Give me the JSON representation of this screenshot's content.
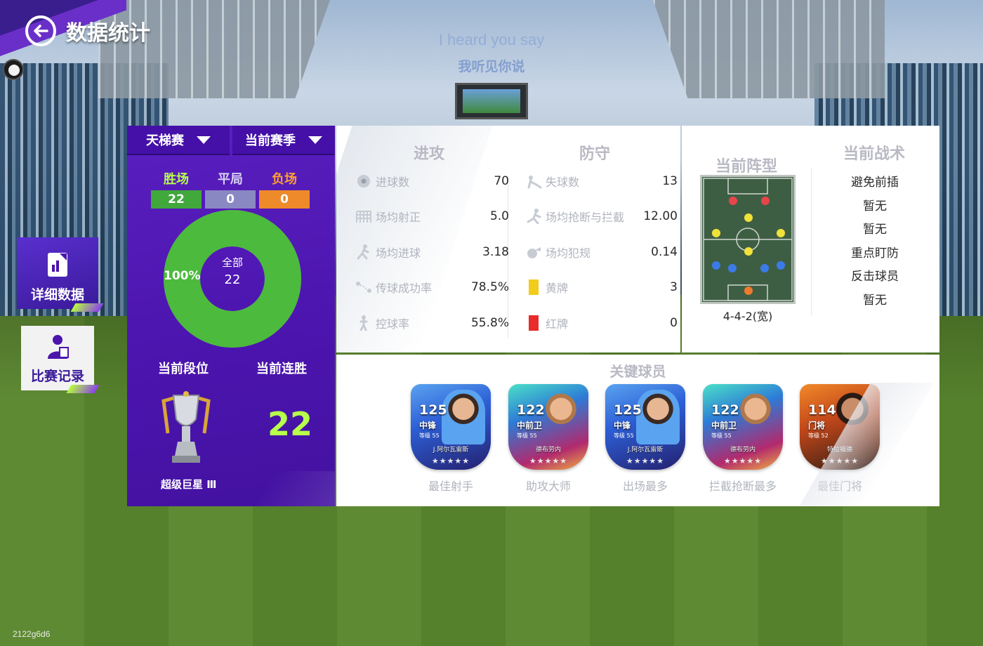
{
  "header": {
    "title": "数据统计"
  },
  "overlay": {
    "lyric_en": "I heard you say",
    "lyric_cn": "我听见你说"
  },
  "sidebar": {
    "detail_label": "详细数据",
    "record_label": "比赛记录"
  },
  "summary": {
    "mode_dropdown": "天梯赛",
    "season_dropdown": "当前赛季",
    "wins_label": "胜场",
    "wins": "22",
    "draws_label": "平局",
    "draws": "0",
    "losses_label": "负场",
    "losses": "0",
    "donut_center_label": "全部",
    "donut_center_value": "22",
    "donut_pct": "100%",
    "win_fraction": 1.0,
    "rank_label": "当前段位",
    "streak_label": "当前连胜",
    "streak_value": "22",
    "rank_name": "超级巨星 Ⅲ"
  },
  "stats": {
    "attack_title": "进攻",
    "defense_title": "防守",
    "attack": [
      {
        "icon": "ball-icon",
        "name": "进球数",
        "value": "70"
      },
      {
        "icon": "goal-net-icon",
        "name": "场均射正",
        "value": "5.0"
      },
      {
        "icon": "shooting-player-icon",
        "name": "场均进球",
        "value": "3.18"
      },
      {
        "icon": "pass-icon",
        "name": "传球成功率",
        "value": "78.5%"
      },
      {
        "icon": "possession-icon",
        "name": "控球率",
        "value": "55.8%"
      }
    ],
    "defense": [
      {
        "icon": "conceded-icon",
        "name": "失球数",
        "value": "13"
      },
      {
        "icon": "tackle-icon",
        "name": "场均抢断与拦截",
        "value": "12.00"
      },
      {
        "icon": "whistle-icon",
        "name": "场均犯规",
        "value": "0.14"
      },
      {
        "icon": "yellow-card-icon",
        "name": "黄牌",
        "value": "3"
      },
      {
        "icon": "red-card-icon",
        "name": "红牌",
        "value": "0"
      }
    ]
  },
  "formation": {
    "title": "当前阵型",
    "name": "4-4-2(宽)",
    "tactics_title": "当前战术",
    "tactics": [
      "避免前插",
      "暂无",
      "暂无",
      "重点盯防",
      "反击球员",
      "暂无"
    ]
  },
  "key_players": {
    "title": "关键球员",
    "cards": [
      {
        "rating": "125",
        "position": "中锋",
        "level": "等级 55",
        "name": "J.阿尔瓦雷斯",
        "award": "最佳射手",
        "style": "c-blue"
      },
      {
        "rating": "122",
        "position": "中前卫",
        "level": "等级 55",
        "name": "德布劳内",
        "award": "助攻大师",
        "style": "c-teal"
      },
      {
        "rating": "125",
        "position": "中锋",
        "level": "等级 55",
        "name": "J.阿尔瓦雷斯",
        "award": "出场最多",
        "style": "c-blue"
      },
      {
        "rating": "122",
        "position": "中前卫",
        "level": "等级 55",
        "name": "德布劳内",
        "award": "拦截抢断最多",
        "style": "c-teal"
      },
      {
        "rating": "114",
        "position": "门将",
        "level": "等级 52",
        "name": "特拉福德",
        "award": "最佳门将",
        "style": "c-orange"
      }
    ]
  },
  "footer": {
    "id": "2122g6d6"
  },
  "colors": {
    "panel_purple": "#4b14ad",
    "win_green": "#41a83c",
    "draw_gray": "#8a88c2",
    "loss_orange": "#ee8a2a",
    "accent_lime": "#b6ff4a"
  }
}
